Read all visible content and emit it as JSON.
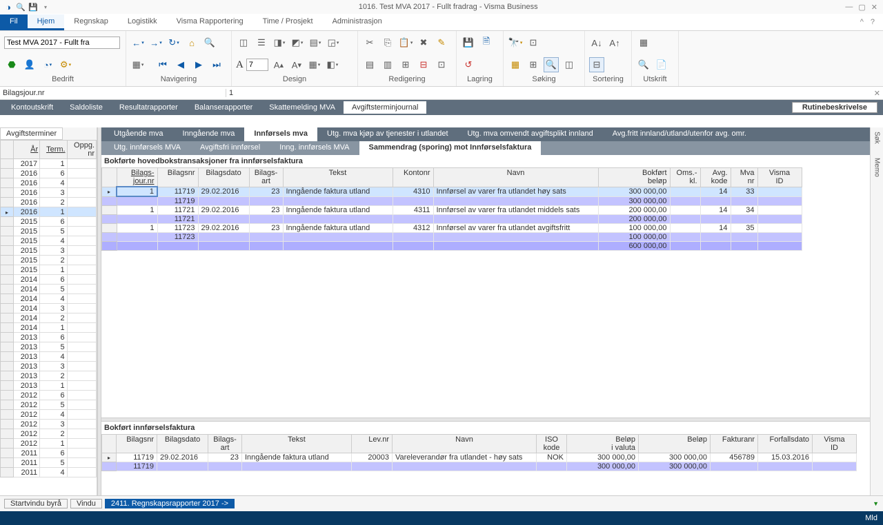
{
  "window": {
    "title": "1016. Test MVA 2017 - Fullt fradrag -  Visma Business",
    "company_dropdown": "Test MVA 2017 - Fullt fra"
  },
  "menubar": {
    "file": "Fil",
    "tabs": [
      "Hjem",
      "Regnskap",
      "Logistikk",
      "Visma Rapportering",
      "Time / Prosjekt",
      "Administrasjon"
    ],
    "active": 0
  },
  "ribbon": {
    "groups": [
      "Bedrift",
      "Navigering",
      "Design",
      "Redigering",
      "Lagring",
      "Søking",
      "Sortering",
      "Utskrift"
    ],
    "font_size": "7"
  },
  "formula": {
    "name": "Bilagsjour.nr",
    "value": "1"
  },
  "nav_tabs": [
    "Kontoutskrift",
    "Saldoliste",
    "Resultatrapporter",
    "Balanserapporter",
    "Skattemelding MVA",
    "Avgiftsterminjournal"
  ],
  "nav_active": 5,
  "rutine_btn": "Rutinebeskrivelse",
  "left_pane": {
    "tab": "Avgiftsterminer",
    "headers": [
      "År",
      "Term.",
      "Oppg. nr"
    ],
    "rows": [
      [
        "2017",
        "1",
        ""
      ],
      [
        "2016",
        "6",
        ""
      ],
      [
        "2016",
        "4",
        ""
      ],
      [
        "2016",
        "3",
        ""
      ],
      [
        "2016",
        "2",
        ""
      ],
      [
        "2016",
        "1",
        ""
      ],
      [
        "2015",
        "6",
        ""
      ],
      [
        "2015",
        "5",
        ""
      ],
      [
        "2015",
        "4",
        ""
      ],
      [
        "2015",
        "3",
        ""
      ],
      [
        "2015",
        "2",
        ""
      ],
      [
        "2015",
        "1",
        ""
      ],
      [
        "2014",
        "6",
        ""
      ],
      [
        "2014",
        "5",
        ""
      ],
      [
        "2014",
        "4",
        ""
      ],
      [
        "2014",
        "3",
        ""
      ],
      [
        "2014",
        "2",
        ""
      ],
      [
        "2014",
        "1",
        ""
      ],
      [
        "2013",
        "6",
        ""
      ],
      [
        "2013",
        "5",
        ""
      ],
      [
        "2013",
        "4",
        ""
      ],
      [
        "2013",
        "3",
        ""
      ],
      [
        "2013",
        "2",
        ""
      ],
      [
        "2013",
        "1",
        ""
      ],
      [
        "2012",
        "6",
        ""
      ],
      [
        "2012",
        "5",
        ""
      ],
      [
        "2012",
        "4",
        ""
      ],
      [
        "2012",
        "3",
        ""
      ],
      [
        "2012",
        "2",
        ""
      ],
      [
        "2012",
        "1",
        ""
      ],
      [
        "2011",
        "6",
        ""
      ],
      [
        "2011",
        "5",
        ""
      ],
      [
        "2011",
        "4",
        ""
      ]
    ],
    "selected": 5
  },
  "inner_tabs": [
    "Utgående mva",
    "Inngående mva",
    "Innførsels mva",
    "Utg. mva kjøp av tjenester i utlandet",
    "Utg. mva omvendt avgiftsplikt innland",
    "Avg.fritt innland/utland/utenfor avg. omr."
  ],
  "inner_active": 2,
  "sub_tabs": [
    "Utg. innførsels MVA",
    "Avgiftsfri innførsel",
    "Inng. innførsels MVA",
    "Sammendrag (sporing) mot Innførselsfaktura"
  ],
  "sub_active": 3,
  "grid1": {
    "title": "Bokførte hovedbokstransaksjoner fra innførselsfaktura",
    "headers": [
      "Bilags- jour.nr",
      "Bilagsnr",
      "Bilagsdato",
      "Bilags- art",
      "Tekst",
      "Kontonr",
      "Navn",
      "Bokført beløp",
      "Oms.- kl.",
      "Avg. kode",
      "Mva nr",
      "Visma ID"
    ],
    "rows": [
      {
        "cls": "sel",
        "c": [
          "1",
          "11719",
          "29.02.2016",
          "23",
          "Inngående faktura utland",
          "4310",
          "Innførsel av varer fra utlandet høy sats",
          "300 000,00",
          "",
          "14",
          "33",
          ""
        ]
      },
      {
        "cls": "sub",
        "c": [
          "",
          "11719",
          "",
          "",
          "",
          "",
          "",
          "300 000,00",
          "",
          "",
          "",
          ""
        ]
      },
      {
        "cls": "",
        "c": [
          "1",
          "11721",
          "29.02.2016",
          "23",
          "Inngående faktura utland",
          "4311",
          "Innførsel av varer fra utlandet middels sats",
          "200 000,00",
          "",
          "14",
          "34",
          ""
        ]
      },
      {
        "cls": "sub",
        "c": [
          "",
          "11721",
          "",
          "",
          "",
          "",
          "",
          "200 000,00",
          "",
          "",
          "",
          ""
        ]
      },
      {
        "cls": "",
        "c": [
          "1",
          "11723",
          "29.02.2016",
          "23",
          "Inngående faktura utland",
          "4312",
          "Innførsel av varer fra utlandet avgiftsfritt",
          "100 000,00",
          "",
          "14",
          "35",
          ""
        ]
      },
      {
        "cls": "sub",
        "c": [
          "",
          "11723",
          "",
          "",
          "",
          "",
          "",
          "100 000,00",
          "",
          "",
          "",
          ""
        ]
      },
      {
        "cls": "total",
        "c": [
          "",
          "",
          "",
          "",
          "",
          "",
          "",
          "600 000,00",
          "",
          "",
          "",
          ""
        ]
      }
    ]
  },
  "grid2": {
    "title": "Bokført innførselsfaktura",
    "headers": [
      "Bilagsnr",
      "Bilagsdato",
      "Bilags- art",
      "Tekst",
      "Lev.nr",
      "Navn",
      "ISO kode",
      "Beløp i valuta",
      "Beløp",
      "Fakturanr",
      "Forfallsdato",
      "Visma ID"
    ],
    "rows": [
      {
        "cls": "",
        "c": [
          "11719",
          "29.02.2016",
          "23",
          "Inngående faktura utland",
          "20003",
          "Vareleverandør fra utlandet - høy sats",
          "NOK",
          "300 000,00",
          "300 000,00",
          "456789",
          "15.03.2016",
          ""
        ]
      },
      {
        "cls": "sub",
        "c": [
          "11719",
          "",
          "",
          "",
          "",
          "",
          "",
          "300 000,00",
          "300 000,00",
          "",
          "",
          ""
        ]
      }
    ]
  },
  "bottom": {
    "tabs": [
      "Startvindu byrå",
      "Vindu",
      "2411. Regnskapsrapporter 2017 ->"
    ],
    "active": 2,
    "status": "Mld"
  },
  "side_tabs": [
    "Søk",
    "Memo"
  ]
}
